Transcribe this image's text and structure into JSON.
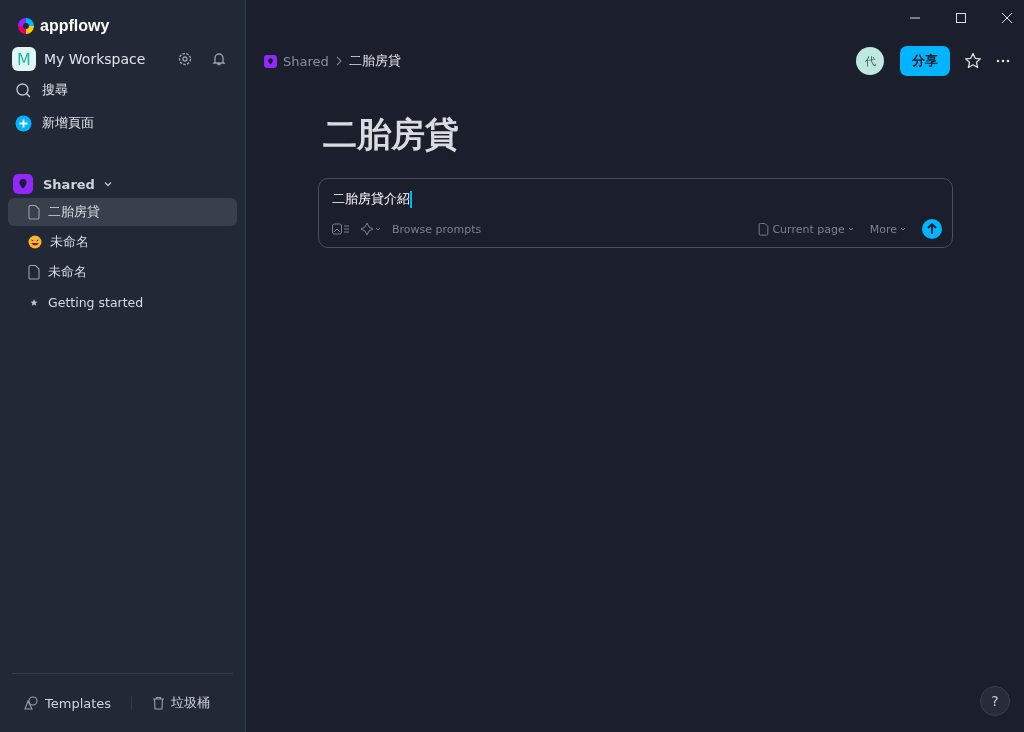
{
  "app": {
    "logo": "appflowy"
  },
  "workspace": {
    "initial": "M",
    "name": "My Workspace"
  },
  "actions": [
    {
      "kind": "search",
      "label": "搜尋"
    },
    {
      "kind": "new",
      "label": "新增頁面"
    }
  ],
  "space": {
    "name": "Shared",
    "expanded": true
  },
  "pages": [
    {
      "kind": "page",
      "label": "二胎房貸",
      "selected": true
    },
    {
      "kind": "emoji",
      "label": "未命名",
      "selected": false
    },
    {
      "kind": "page",
      "label": "未命名",
      "selected": false
    },
    {
      "kind": "star",
      "label": "Getting started",
      "selected": false
    }
  ],
  "footer": {
    "templates": "Templates",
    "trash": "垃圾桶"
  },
  "breadcrumb": [
    {
      "kind": "space",
      "label": "Shared"
    },
    {
      "kind": "page",
      "label": "二胎房貸"
    }
  ],
  "header": {
    "avatar": "代",
    "share": "分享"
  },
  "page": {
    "title": "二胎房貸"
  },
  "ai_input": {
    "value": "二胎房貸介紹",
    "browse": "Browse prompts",
    "scope": "Current page",
    "more": "More"
  },
  "help": "?"
}
